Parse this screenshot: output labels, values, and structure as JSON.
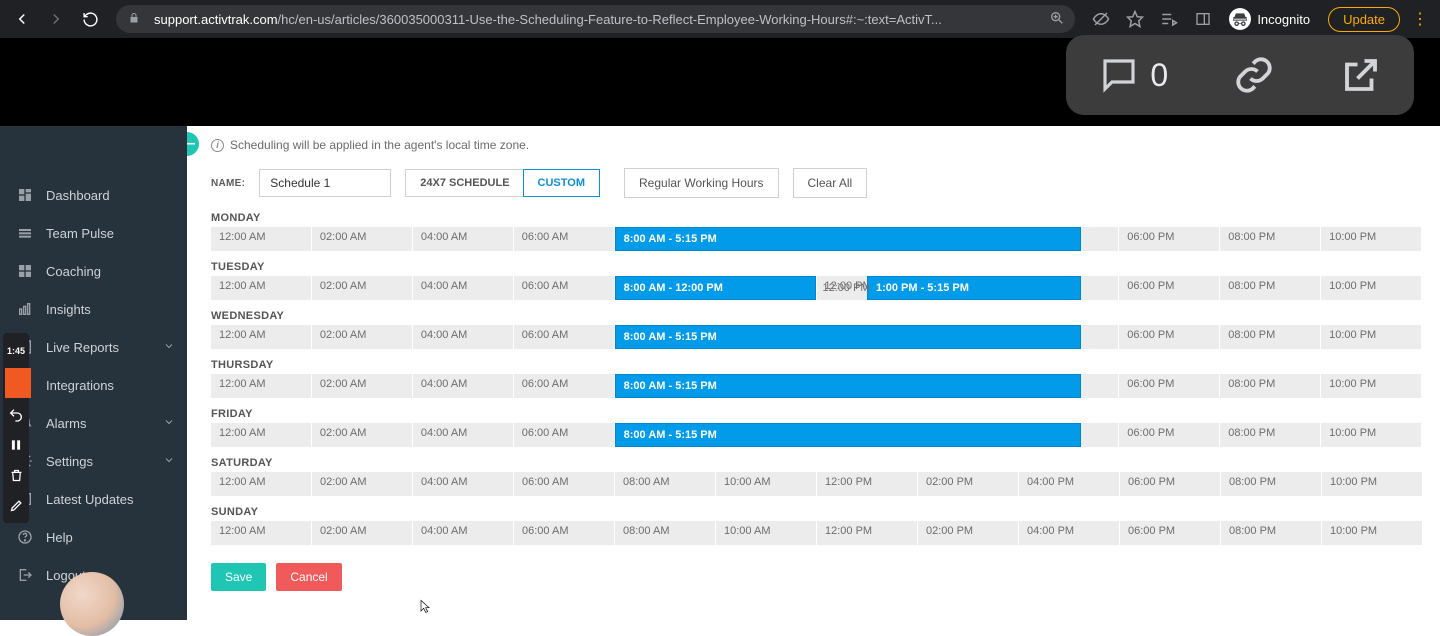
{
  "browser": {
    "url_host": "support.activtrak.com",
    "url_path": "/hc/en-us/articles/360035000311-Use-the-Scheduling-Feature-to-Reflect-Employee-Working-Hours#:~:text=ActivT...",
    "incognito_label": "Incognito",
    "update_label": "Update"
  },
  "overlay": {
    "comment_count": "0"
  },
  "sidebar": {
    "items": [
      {
        "label": "Dashboard",
        "icon": "dashboard"
      },
      {
        "label": "Team Pulse",
        "icon": "pulse"
      },
      {
        "label": "Coaching",
        "icon": "coaching"
      },
      {
        "label": "Insights",
        "icon": "insights"
      },
      {
        "label": "Live Reports",
        "icon": "reports",
        "expandable": true
      },
      {
        "label": "Integrations",
        "icon": "integrations"
      },
      {
        "label": "Alarms",
        "icon": "alarms",
        "expandable": true
      },
      {
        "label": "Settings",
        "icon": "settings",
        "expandable": true
      },
      {
        "label": "Latest Updates",
        "icon": "updates"
      },
      {
        "label": "Help",
        "icon": "help"
      },
      {
        "label": "Logout",
        "icon": "logout"
      }
    ],
    "badge_time": "1:45"
  },
  "schedule": {
    "info_text": "Scheduling will be applied in the agent's local time zone.",
    "name_label": "NAME:",
    "name_value": "Schedule 1",
    "mode_247": "24X7 SCHEDULE",
    "mode_custom": "CUSTOM",
    "regular_btn": "Regular Working Hours",
    "clear_btn": "Clear All",
    "ticks": [
      "12:00 AM",
      "02:00 AM",
      "04:00 AM",
      "06:00 AM",
      "08:00 AM",
      "10:00 AM",
      "12:00 PM",
      "02:00 PM",
      "04:00 PM",
      "06:00 PM",
      "08:00 PM",
      "10:00 PM"
    ],
    "days": [
      {
        "name": "MONDAY",
        "blocks": [
          {
            "label": "8:00 AM - 5:15 PM",
            "start": 8,
            "end": 17.25
          }
        ]
      },
      {
        "name": "TUESDAY",
        "blocks": [
          {
            "label": "8:00 AM - 12:00 PM",
            "start": 8,
            "end": 12
          },
          {
            "label": "1:00 PM - 5:15 PM",
            "start": 13,
            "end": 17.25
          }
        ],
        "gap": {
          "label": "12:00 PM",
          "at": 12
        }
      },
      {
        "name": "WEDNESDAY",
        "blocks": [
          {
            "label": "8:00 AM - 5:15 PM",
            "start": 8,
            "end": 17.25
          }
        ]
      },
      {
        "name": "THURSDAY",
        "blocks": [
          {
            "label": "8:00 AM - 5:15 PM",
            "start": 8,
            "end": 17.25
          }
        ]
      },
      {
        "name": "FRIDAY",
        "blocks": [
          {
            "label": "8:00 AM - 5:15 PM",
            "start": 8,
            "end": 17.25
          }
        ]
      },
      {
        "name": "SATURDAY",
        "blocks": []
      },
      {
        "name": "SUNDAY",
        "blocks": []
      }
    ],
    "save_label": "Save",
    "cancel_label": "Cancel"
  }
}
